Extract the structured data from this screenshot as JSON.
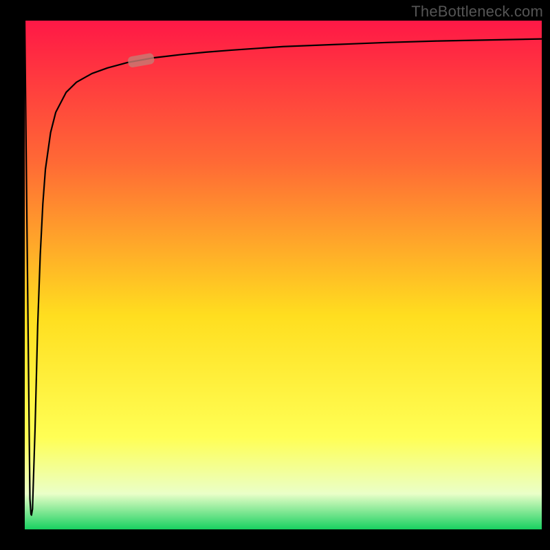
{
  "watermark": {
    "text": "TheBottleneck.com"
  },
  "colors": {
    "frame": "#000000",
    "grad_top": "#ff1846",
    "grad_mid1": "#ff6a35",
    "grad_mid2": "#ffde1f",
    "grad_low": "#ffff55",
    "grad_bottom_pale": "#eaffc8",
    "grad_green": "#18d060",
    "curve": "#000000",
    "marker_fill": "#c77a73"
  },
  "plot": {
    "inner_x": 36,
    "inner_y": 30,
    "inner_w": 752,
    "inner_h": 740
  },
  "chart_data": {
    "type": "line",
    "title": "",
    "xlabel": "",
    "ylabel": "",
    "xlim": [
      0,
      1
    ],
    "ylim": [
      0,
      1
    ],
    "x": [
      0.0,
      0.01,
      0.012,
      0.013,
      0.015,
      0.02,
      0.025,
      0.03,
      0.035,
      0.04,
      0.05,
      0.06,
      0.08,
      0.1,
      0.13,
      0.16,
      0.2,
      0.25,
      0.3,
      0.35,
      0.4,
      0.5,
      0.6,
      0.7,
      0.8,
      0.9,
      1.0
    ],
    "values": [
      1.0,
      0.06,
      0.03,
      0.028,
      0.04,
      0.2,
      0.4,
      0.54,
      0.64,
      0.708,
      0.78,
      0.82,
      0.859,
      0.879,
      0.896,
      0.907,
      0.918,
      0.927,
      0.933,
      0.938,
      0.942,
      0.949,
      0.953,
      0.957,
      0.96,
      0.962,
      0.964
    ],
    "marker": {
      "x": 0.225,
      "y": 0.922
    },
    "series": []
  }
}
